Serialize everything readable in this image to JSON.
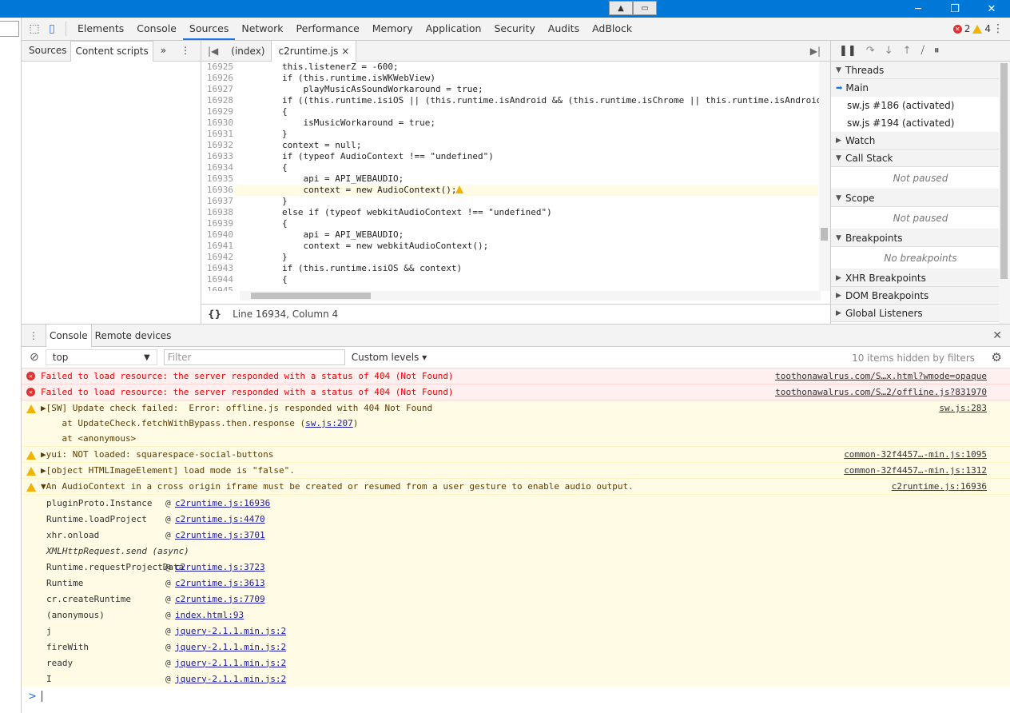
{
  "titlebar": {
    "center_left_icon": "up-arrow-icon",
    "center_right_icon": "image-icon",
    "minimize": "─",
    "restore": "❐",
    "close": "✕"
  },
  "main_tabs": [
    "Elements",
    "Console",
    "Sources",
    "Network",
    "Performance",
    "Memory",
    "Application",
    "Security",
    "Audits",
    "AdBlock"
  ],
  "active_main_tab": "Sources",
  "error_count": "2",
  "warning_count": "4",
  "navigator": {
    "tabs": [
      "Sources",
      "Content scripts"
    ],
    "more": "»"
  },
  "editor": {
    "tabs": [
      "(index)",
      "c2runtime.js"
    ],
    "close": "×",
    "status": "Line 16934, Column 4",
    "format_icon": "{}",
    "lines": [
      {
        "n": "16925",
        "code": "        this.listenerZ = -600;"
      },
      {
        "n": "16926",
        "code": "        if (this.runtime.isWKWebView)"
      },
      {
        "n": "16927",
        "code": "            playMusicAsSoundWorkaround = true;"
      },
      {
        "n": "16928",
        "code": "        if ((this.runtime.isiOS || (this.runtime.isAndroid && (this.runtime.isChrome || this.runtime.isAndroid"
      },
      {
        "n": "16929",
        "code": "        {"
      },
      {
        "n": "16930",
        "code": "            isMusicWorkaround = true;"
      },
      {
        "n": "16931",
        "code": "        }"
      },
      {
        "n": "16932",
        "code": "        context = null;"
      },
      {
        "n": "16933",
        "code": "        if (typeof AudioContext !== \"undefined\")"
      },
      {
        "n": "16934",
        "code": "        {"
      },
      {
        "n": "16935",
        "code": "            api = API_WEBAUDIO;"
      },
      {
        "n": "16936",
        "code": "            context = new AudioContext();"
      },
      {
        "n": "16937",
        "code": "        }"
      },
      {
        "n": "16938",
        "code": "        else if (typeof webkitAudioContext !== \"undefined\")"
      },
      {
        "n": "16939",
        "code": "        {"
      },
      {
        "n": "16940",
        "code": "            api = API_WEBAUDIO;"
      },
      {
        "n": "16941",
        "code": "            context = new webkitAudioContext();"
      },
      {
        "n": "16942",
        "code": "        }"
      },
      {
        "n": "16943",
        "code": "        if (this.runtime.isiOS && context)"
      },
      {
        "n": "16944",
        "code": "        {"
      },
      {
        "n": "16945",
        "code": ""
      }
    ]
  },
  "debugger": {
    "threads_label": "Threads",
    "threads": [
      "Main",
      "sw.js #186 (activated)",
      "sw.js #194 (activated)"
    ],
    "watch": "Watch",
    "call_stack": "Call Stack",
    "not_paused": "Not paused",
    "scope": "Scope",
    "breakpoints": "Breakpoints",
    "no_breakpoints": "No breakpoints",
    "xhr": "XHR Breakpoints",
    "dom": "DOM Breakpoints",
    "global": "Global Listeners"
  },
  "drawer": {
    "tabs": [
      "Console",
      "Remote devices"
    ],
    "context": "top",
    "filter_placeholder": "Filter",
    "levels": "Custom levels ▾",
    "hidden_info": "10 items hidden by filters"
  },
  "messages": [
    {
      "type": "err",
      "text": "Failed to load resource: the server responded with a status of 404 (Not Found)",
      "src": "toothonawalrus.com/S…x.html?wmode=opaque"
    },
    {
      "type": "err",
      "text": "Failed to load resource: the server responded with a status of 404 (Not Found)",
      "src": "toothonawalrus.com/S…2/offline.js?831970"
    },
    {
      "type": "warn",
      "line1": "▶[SW] Update check failed:  Error: offline.js responded with 404 Not Found",
      "line2": "    at UpdateCheck.fetchWithBypass.then.response (",
      "line2link": "sw.js:207",
      "line2end": ")",
      "line3": "    at <anonymous>",
      "src": "sw.js:283"
    },
    {
      "type": "warn",
      "text": "▶yui: NOT loaded: squarespace-social-buttons",
      "src": "common-32f4457…-min.js:1095"
    },
    {
      "type": "warn",
      "text": "▶[object HTMLImageElement] load mode is \"false\".",
      "src": "common-32f4457…-min.js:1312"
    },
    {
      "type": "warn",
      "text": "▼An AudioContext in a cross origin iframe must be created or resumed from a user gesture to enable audio output.",
      "src": "c2runtime.js:16936"
    }
  ],
  "stack": [
    {
      "fn": "pluginProto.Instance",
      "link": "c2runtime.js:16936"
    },
    {
      "fn": "Runtime.loadProject",
      "link": "c2runtime.js:4470"
    },
    {
      "fn": "xhr.onload",
      "link": "c2runtime.js:3701"
    },
    {
      "fn": "XMLHttpRequest.send (async)",
      "link": ""
    },
    {
      "fn": "Runtime.requestProjectData",
      "link": "c2runtime.js:3723"
    },
    {
      "fn": "Runtime",
      "link": "c2runtime.js:3613"
    },
    {
      "fn": "cr.createRuntime",
      "link": "c2runtime.js:7709"
    },
    {
      "fn": "(anonymous)",
      "link": "index.html:93"
    },
    {
      "fn": "j",
      "link": "jquery-2.1.1.min.js:2"
    },
    {
      "fn": "fireWith",
      "link": "jquery-2.1.1.min.js:2"
    },
    {
      "fn": "ready",
      "link": "jquery-2.1.1.min.js:2"
    },
    {
      "fn": "I",
      "link": "jquery-2.1.1.min.js:2"
    }
  ],
  "prompt_symbol": ">"
}
